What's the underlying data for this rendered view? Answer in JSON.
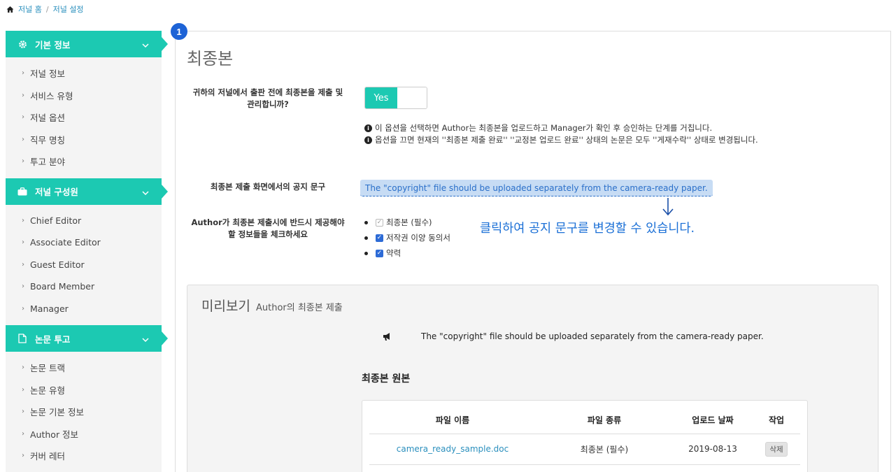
{
  "breadcrumb": {
    "home": "저널 홈",
    "current": "저널 설정",
    "separator": "/"
  },
  "sidebar": {
    "sections": [
      {
        "title": "기본 정보",
        "icon": "gear-icon",
        "items": [
          "저널 정보",
          "서비스 유형",
          "저널 옵션",
          "직무 명칭",
          "투고 분야"
        ]
      },
      {
        "title": "저널 구성원",
        "icon": "briefcase-icon",
        "items": [
          "Chief Editor",
          "Associate Editor",
          "Guest Editor",
          "Board Member",
          "Manager"
        ]
      },
      {
        "title": "논문 투고",
        "icon": "document-icon",
        "items": [
          "논문 트랙",
          "논문 유형",
          "논문 기본 정보",
          "Author 정보",
          "커버 레터"
        ]
      }
    ]
  },
  "badge": "1",
  "main": {
    "title": "최종본",
    "q1": {
      "label_line1": "귀하의 저널에서 출판 전에 최종본을 제출 및",
      "label_line2": "관리합니까?",
      "toggle": "Yes"
    },
    "info": [
      "이 옵션을 선택하면 Author는 최종본을 업로드하고 Manager가 확인 후 승인하는 단계를 거칩니다.",
      "옵션을 끄면 현재의 ''최종본 제출 완료'' ''교정본 업로드 완료'' 상태의 논문은 모두 ''게재수락'' 상태로 변경됩니다."
    ],
    "notice": {
      "label": "최종본 제출 화면에서의 공지 문구",
      "value": "The \"copyright\" file should be uploaded separately from the camera-ready paper."
    },
    "hint": "클릭하여 공지 문구를 변경할 수 있습니다.",
    "required": {
      "label_line1": "Author가 최종본 제출시에 반드시 제공해야",
      "label_line2": "할 정보들을 체크하세요",
      "items": [
        "최종본 (필수)",
        "저작권 이양 동의서",
        "약력"
      ]
    }
  },
  "preview": {
    "title": "미리보기",
    "subtitle": "Author의 최종본 제출",
    "notice": "The \"copyright\" file should be uploaded separately from the camera-ready paper.",
    "section_title": "최종본 원본",
    "table": {
      "headers": [
        "파일 이름",
        "파일 종류",
        "업로드 날짜",
        "작업"
      ],
      "rows": [
        {
          "name": "camera_ready_sample.doc",
          "type": "최종본 (필수)",
          "date": "2019-08-13",
          "action": "삭제"
        }
      ]
    }
  },
  "colors": {
    "accent": "#1cc9b2",
    "link": "#2a8fbd",
    "badge": "#1d63d6",
    "hint": "#1a6fd6"
  }
}
